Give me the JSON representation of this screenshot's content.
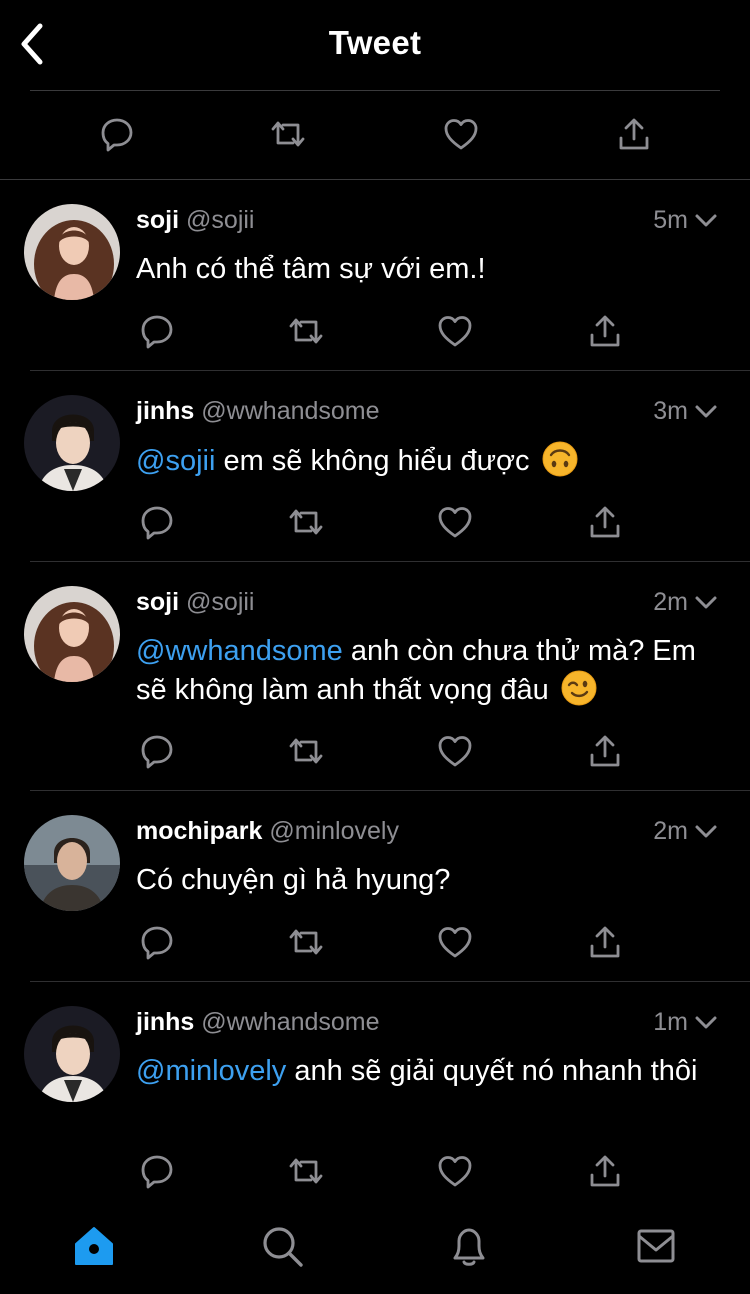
{
  "header": {
    "title": "Tweet",
    "back_icon": "chevron-left-icon"
  },
  "colors": {
    "accent": "#3da0f0",
    "muted": "#8e8e93",
    "background": "#000000",
    "divider": "#3a3a3c"
  },
  "tweets": [
    {
      "name": "soji",
      "handle": "@sojii",
      "time": "5m",
      "mention": "",
      "text": "Anh có thể tâm sự với em.!",
      "emoji": ""
    },
    {
      "name": "jinhs",
      "handle": "@wwhandsome",
      "time": "3m",
      "mention": "@sojii",
      "text": " em sẽ không hiểu được",
      "emoji": "upside-down-face"
    },
    {
      "name": "soji",
      "handle": "@sojii",
      "time": "2m",
      "mention": "@wwhandsome",
      "text": " anh còn chưa thử mà? Em sẽ không làm anh thất vọng đâu",
      "emoji": "winking-face"
    },
    {
      "name": "mochipark",
      "handle": "@minlovely",
      "time": "2m",
      "mention": "",
      "text": "Có chuyện gì hả hyung?",
      "emoji": ""
    },
    {
      "name": "jinhs",
      "handle": "@wwhandsome",
      "time": "1m",
      "mention": "@minlovely",
      "text": " anh sẽ giải quyết nó nhanh thôi",
      "emoji": ""
    }
  ],
  "tabbar": {
    "items": [
      "home-icon",
      "search-icon",
      "notifications-icon",
      "messages-icon"
    ],
    "active": "home-icon"
  }
}
